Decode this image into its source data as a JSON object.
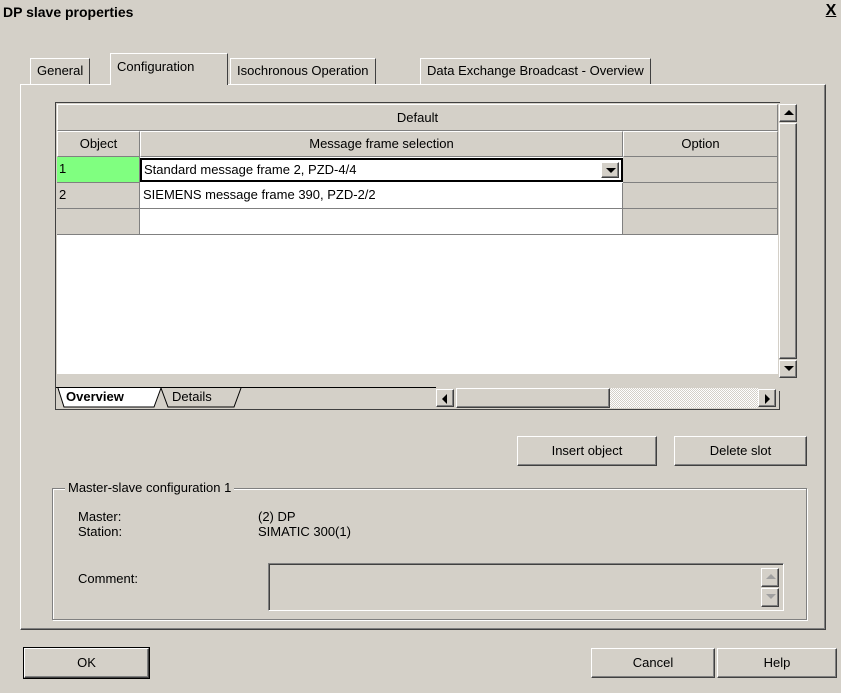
{
  "window": {
    "title": "DP slave properties",
    "close_glyph": "X"
  },
  "tabs": [
    {
      "label": "General"
    },
    {
      "label": "Configuration"
    },
    {
      "label": "Isochronous Operation"
    },
    {
      "label": "Data Exchange Broadcast - Overview"
    }
  ],
  "grid": {
    "group_header": "Default",
    "columns": [
      "Object",
      "Message frame selection",
      "Option"
    ],
    "rows": [
      {
        "object": "1",
        "message": "Standard message frame 2, PZD-4/4",
        "option": ""
      },
      {
        "object": "2",
        "message": "SIEMENS message frame 390, PZD-2/2",
        "option": ""
      },
      {
        "object": "",
        "message": "",
        "option": ""
      }
    ],
    "sheet_tabs": [
      "Overview",
      "Details"
    ]
  },
  "buttons": {
    "insert_object": "Insert object",
    "delete_slot": "Delete slot",
    "ok": "OK",
    "cancel": "Cancel",
    "help": "Help"
  },
  "master_slave": {
    "group_label": "Master-slave configuration 1",
    "master_label": "Master:",
    "master_value": "(2) DP",
    "station_label": "Station:",
    "station_value": "SIMATIC 300(1)",
    "comment_label": "Comment:",
    "comment_value": ""
  },
  "colors": {
    "face": "#d4d0c8",
    "selected_cell": "#80ff80"
  }
}
